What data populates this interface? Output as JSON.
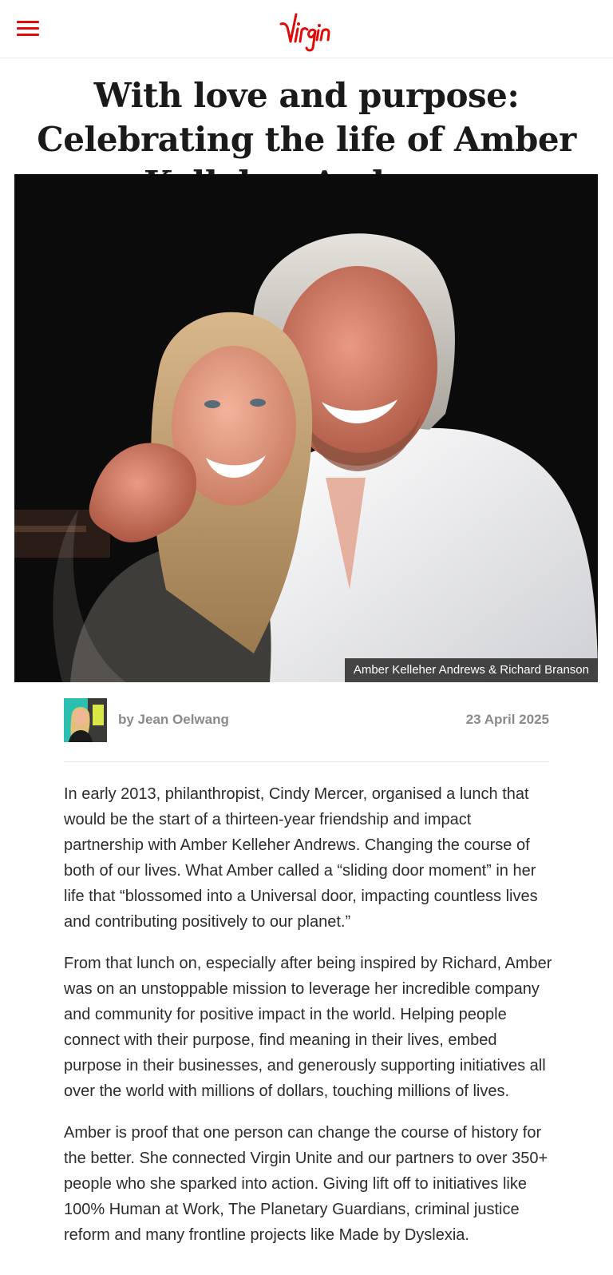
{
  "header": {
    "menu_icon": "hamburger-menu-icon",
    "logo_text": "Virgin",
    "brand_color": "#e10a0a"
  },
  "article": {
    "title": "With love and purpose: Celebrating the life of Amber Kelleher Andrews",
    "hero": {
      "caption": "Amber Kelleher Andrews & Richard Branson"
    },
    "byline": {
      "author": "by Jean Oelwang",
      "date": "23 April 2025"
    },
    "paragraphs": [
      "In early 2013, philanthropist, Cindy Mercer, organised a lunch that would be the start of a thirteen-year friendship and impact partnership with Amber Kelleher Andrews. Changing the course of both of our lives. What Amber called a “sliding door moment” in her life that “blossomed into a Universal door, impacting countless lives and contributing positively to our planet.”",
      "From that lunch on, especially after being inspired by Richard, Amber was on an unstoppable mission to leverage her incredible company and community for positive impact in the world. Helping people connect with their purpose, find meaning in their lives, embed purpose in their businesses, and generously supporting initiatives all over the world with millions of dollars, touching millions of lives.",
      "Amber is proof that one person can change the course of history for the better. She connected Virgin Unite and our partners to over 350+ people who she sparked into action. Giving lift off to initiatives like 100% Human at Work, The Planetary Guardians, criminal justice reform and many frontline projects like Made by Dyslexia."
    ]
  }
}
